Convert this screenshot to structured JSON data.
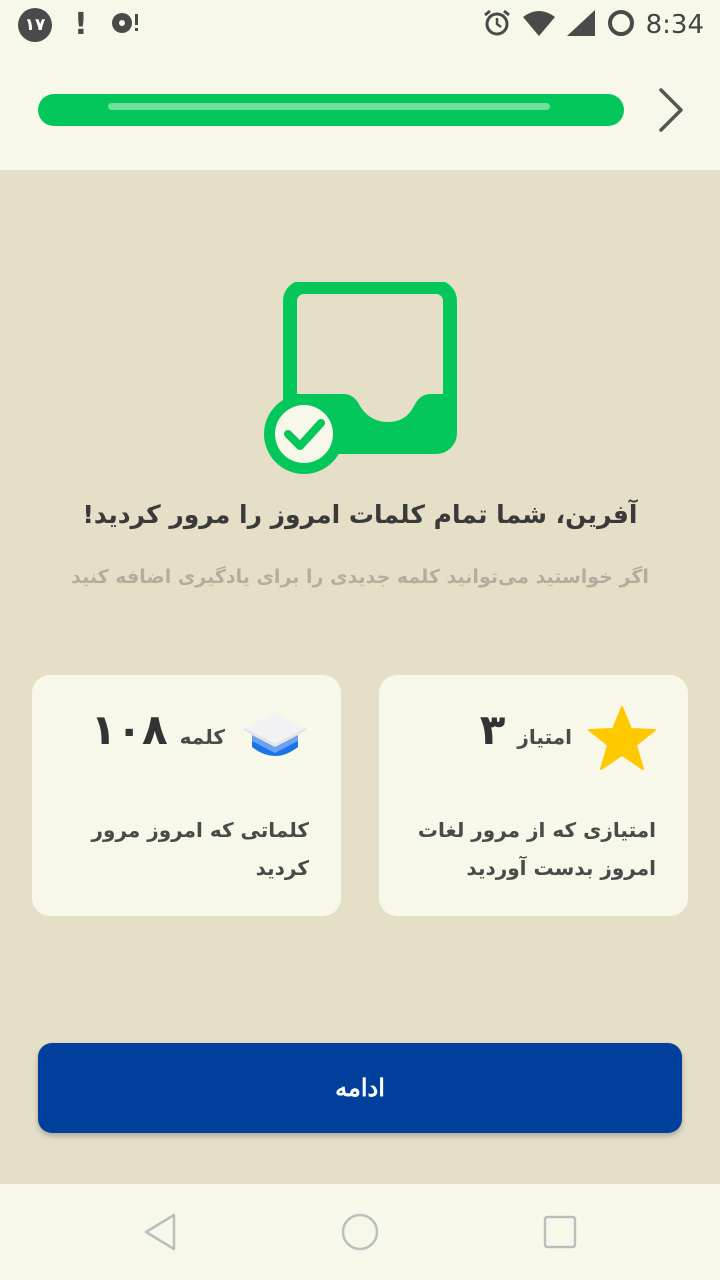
{
  "status_bar": {
    "notification_count": "۱۷",
    "time": "8:34"
  },
  "progress": {
    "fraction": 1.0,
    "color": "#03c75a"
  },
  "completion": {
    "title": "آفرین، شما تمام کلمات امروز را مرور کردید!",
    "subtitle": "اگر خواستید می‌توانید کلمه جدیدی را برای یادگیری اضافه کنید"
  },
  "cards": {
    "score": {
      "icon": "star-icon",
      "label": "امتیاز",
      "value": "۳",
      "description": "امتیازی که از مرور لغات امروز بدست آوردید"
    },
    "words": {
      "icon": "graduation-cap-icon",
      "label": "کلمه",
      "value": "۱۰۸",
      "description": "کلماتی که امروز مرور کردید"
    }
  },
  "continue_button": {
    "label": "ادامه",
    "color": "#00409c"
  },
  "colors": {
    "accent_green": "#03c75a",
    "background": "#e6dfc8",
    "surface": "#f8f8ea",
    "star": "#ffc900",
    "cap_blue": "#1a73e8"
  }
}
